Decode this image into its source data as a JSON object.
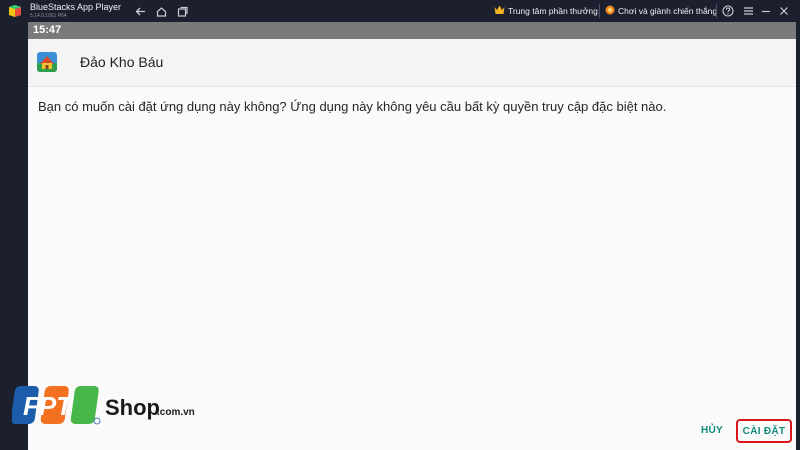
{
  "titlebar": {
    "app_title": "BlueStacks App Player",
    "version": "5.14.0.1061 P64",
    "rewards_label": "Trung tâm phần thưởng",
    "play_win_label": "Chơi và giành chiến thắng"
  },
  "statusbar": {
    "time": "15:47"
  },
  "dialog": {
    "app_name": "Đảo Kho Báu",
    "message": "Bạn có muốn cài đặt ứng dụng này không? Ứng dụng này không yêu cầu bất kỳ quyền truy cập đặc biệt nào.",
    "cancel_label": "HỦY",
    "install_label": "CÀI ĐẶT"
  },
  "watermark": {
    "brand": "FPT",
    "shop": "Shop",
    "domain": ".com.vn"
  },
  "colors": {
    "titlebar_bg": "#1b1f2e",
    "statusbar_bg": "#7a7a7a",
    "accent_teal": "#0f8a7a",
    "highlight_red": "#d9171b",
    "fpt_blue": "#1b5cab",
    "fpt_orange": "#f37021",
    "fpt_green": "#47b749"
  },
  "icons": {
    "logo": "bluestacks-logo-icon",
    "back": "back-arrow-icon",
    "home": "home-icon",
    "recents": "recent-apps-icon",
    "crown": "crown-icon",
    "coin": "coin-icon",
    "help": "help-icon",
    "menu": "menu-icon",
    "minimize": "minimize-icon",
    "maximize": "maximize-icon",
    "close": "close-icon"
  }
}
